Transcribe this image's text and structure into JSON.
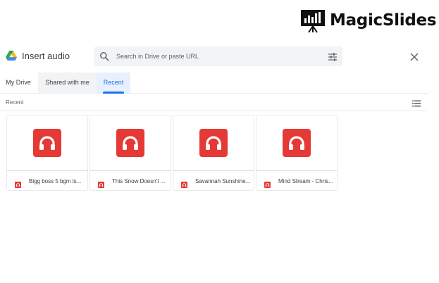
{
  "brand": {
    "name": "MagicSlides"
  },
  "dialog": {
    "title": "Insert audio",
    "search": {
      "placeholder": "Search in Drive or paste URL",
      "value": ""
    }
  },
  "tabs": [
    {
      "label": "My Drive",
      "selected": false
    },
    {
      "label": "Shared with me",
      "selected": false
    },
    {
      "label": "Recent",
      "selected": true
    }
  ],
  "section": {
    "label": "Recent"
  },
  "files": [
    {
      "name": "Bigg boss 5 bgm ls...",
      "type": "audio"
    },
    {
      "name": "This Snow Doesn't ...",
      "type": "audio"
    },
    {
      "name": "Savannah Sunshine...",
      "type": "audio"
    },
    {
      "name": "Mind Stream - Chris...",
      "type": "audio"
    }
  ],
  "icons": {
    "drive": "google-drive-icon",
    "search": "search-icon",
    "tune": "tune-icon",
    "close": "close-icon",
    "list_view": "list-view-icon",
    "audio": "headphones-icon"
  },
  "colors": {
    "accent": "#1a73e8",
    "audio_red": "#e53935",
    "selected_tab_bg": "#e8f0fe",
    "search_bg": "#f1f3f4"
  }
}
